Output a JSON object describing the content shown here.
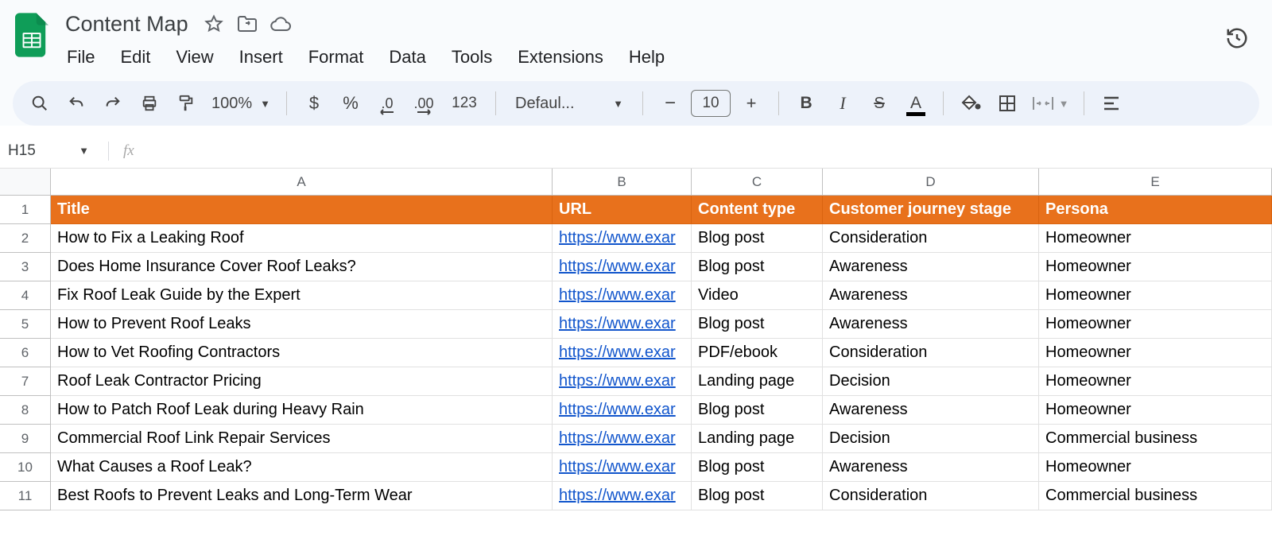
{
  "doc": {
    "title": "Content Map"
  },
  "menu": {
    "file": "File",
    "edit": "Edit",
    "view": "View",
    "insert": "Insert",
    "format": "Format",
    "data": "Data",
    "tools": "Tools",
    "extensions": "Extensions",
    "help": "Help"
  },
  "toolbar": {
    "zoom": "100%",
    "currency": "$",
    "percent": "%",
    "decrease_dec": ".0",
    "increase_dec": ".00",
    "numfmt": "123",
    "font": "Defaul...",
    "minus": "−",
    "font_size": "10",
    "plus": "+",
    "bold": "B",
    "italic": "I",
    "strike": "S",
    "textcolor": "A"
  },
  "namebox": {
    "ref": "H15",
    "fx": "fx"
  },
  "columns": [
    "A",
    "B",
    "C",
    "D",
    "E"
  ],
  "headers": {
    "title": "Title",
    "url": "URL",
    "type": "Content type",
    "stage": "Customer journey stage",
    "persona": "Persona"
  },
  "rows": [
    {
      "n": "2",
      "title": "How to Fix a Leaking Roof",
      "url": "https://www.exar",
      "type": "Blog post",
      "stage": "Consideration",
      "persona": "Homeowner"
    },
    {
      "n": "3",
      "title": "Does Home Insurance Cover Roof Leaks?",
      "url": "https://www.exar",
      "type": "Blog post",
      "stage": "Awareness",
      "persona": "Homeowner"
    },
    {
      "n": "4",
      "title": "Fix Roof Leak Guide by the Expert",
      "url": "https://www.exar",
      "type": "Video",
      "stage": "Awareness",
      "persona": "Homeowner"
    },
    {
      "n": "5",
      "title": "How to Prevent Roof Leaks",
      "url": "https://www.exar",
      "type": "Blog post",
      "stage": "Awareness",
      "persona": "Homeowner"
    },
    {
      "n": "6",
      "title": "How to Vet Roofing Contractors",
      "url": "https://www.exar",
      "type": "PDF/ebook",
      "stage": "Consideration",
      "persona": "Homeowner"
    },
    {
      "n": "7",
      "title": "Roof Leak Contractor Pricing",
      "url": "https://www.exar",
      "type": "Landing page",
      "stage": "Decision",
      "persona": "Homeowner"
    },
    {
      "n": "8",
      "title": "How to Patch Roof Leak during Heavy Rain",
      "url": "https://www.exar",
      "type": "Blog post",
      "stage": "Awareness",
      "persona": "Homeowner"
    },
    {
      "n": "9",
      "title": "Commercial Roof Link Repair Services",
      "url": "https://www.exar",
      "type": "Landing page",
      "stage": "Decision",
      "persona": "Commercial business"
    },
    {
      "n": "10",
      "title": "What Causes a Roof Leak?",
      "url": "https://www.exar",
      "type": "Blog post",
      "stage": "Awareness",
      "persona": "Homeowner"
    },
    {
      "n": "11",
      "title": "Best Roofs to Prevent Leaks and Long-Term Wear",
      "url": "https://www.exar",
      "type": "Blog post",
      "stage": "Consideration",
      "persona": "Commercial business"
    }
  ]
}
